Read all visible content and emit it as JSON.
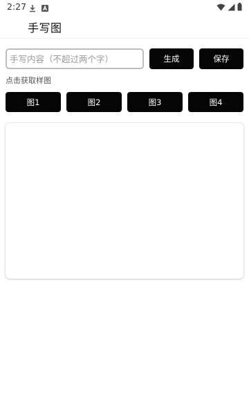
{
  "status_bar": {
    "time": "2:27",
    "icons": [
      "download-icon",
      "a-box-icon",
      "wifi-icon",
      "signal-icon",
      "battery-icon"
    ]
  },
  "app_bar": {
    "title": "手写图"
  },
  "form": {
    "input_value": "",
    "input_placeholder": "手写内容（不超过两个字）",
    "generate_label": "生成",
    "save_label": "保存"
  },
  "samples": {
    "hint": "点击获取样图",
    "buttons": [
      "图1",
      "图2",
      "图3",
      "图4"
    ]
  },
  "colors": {
    "button_bg": "#050505",
    "button_text": "#ffffff",
    "input_border": "#bdbdbd"
  }
}
